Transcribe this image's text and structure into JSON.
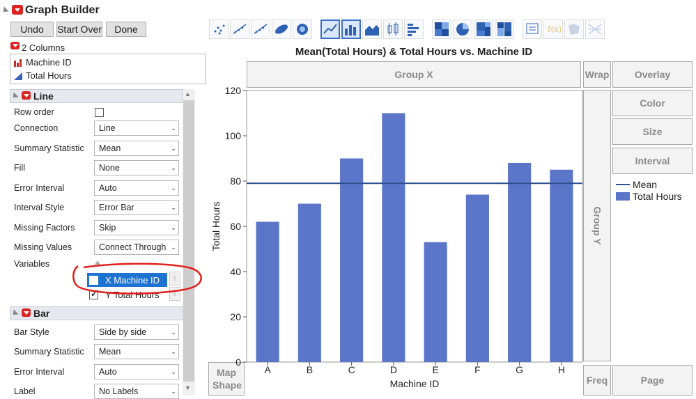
{
  "app": {
    "title": "Graph Builder"
  },
  "toolbar": {
    "undo": "Undo",
    "start_over": "Start Over",
    "done": "Done"
  },
  "columns": {
    "header": "2 Columns",
    "items": [
      {
        "name": "Machine ID",
        "icon": "nominal-bar-icon"
      },
      {
        "name": "Total Hours",
        "icon": "continuous-triangle-icon"
      }
    ]
  },
  "line_panel": {
    "title": "Line",
    "row_order": "Row order",
    "rows": [
      {
        "label": "Connection",
        "value": "Line"
      },
      {
        "label": "Summary Statistic",
        "value": "Mean"
      },
      {
        "label": "Fill",
        "value": "None"
      },
      {
        "label": "Error Interval",
        "value": "Auto"
      },
      {
        "label": "Interval Style",
        "value": "Error Bar"
      },
      {
        "label": "Missing Factors",
        "value": "Skip"
      },
      {
        "label": "Missing Values",
        "value": "Connect Through"
      }
    ],
    "variables_label": "Variables",
    "variables": [
      {
        "text": "X  Machine ID",
        "checked": false,
        "selected": true
      },
      {
        "text": "Y  Total Hours",
        "checked": true,
        "selected": false
      }
    ]
  },
  "bar_panel": {
    "title": "Bar",
    "rows": [
      {
        "label": "Bar Style",
        "value": "Side by side"
      },
      {
        "label": "Summary Statistic",
        "value": "Mean"
      },
      {
        "label": "Error Interval",
        "value": "Auto"
      },
      {
        "label": "Label",
        "value": "No Labels"
      }
    ]
  },
  "zones": {
    "group_x": "Group X",
    "group_y": "Group Y",
    "wrap": "Wrap",
    "overlay": "Overlay",
    "color": "Color",
    "size": "Size",
    "interval": "Interval",
    "map_shape": "Map Shape",
    "freq": "Freq",
    "page": "Page"
  },
  "legend": [
    {
      "label": "Mean",
      "kind": "line",
      "color": "#2c4f8f"
    },
    {
      "label": "Total Hours",
      "kind": "bar",
      "color": "#5b76c9"
    }
  ],
  "chart_data": {
    "type": "bar",
    "title": "Mean(Total Hours) & Total Hours vs. Machine ID",
    "xlabel": "Machine ID",
    "ylabel": "Total Hours",
    "categories": [
      "A",
      "B",
      "C",
      "D",
      "E",
      "F",
      "G",
      "H"
    ],
    "series": [
      {
        "name": "Total Hours",
        "values": [
          62,
          70,
          90,
          110,
          53,
          74,
          88,
          85
        ]
      }
    ],
    "mean_line": 79,
    "ylim": [
      0,
      120
    ],
    "yticks": [
      0,
      20,
      40,
      60,
      80,
      100,
      120
    ],
    "colors": {
      "bar": "#5b76c9",
      "mean": "#2c4f8f"
    }
  }
}
